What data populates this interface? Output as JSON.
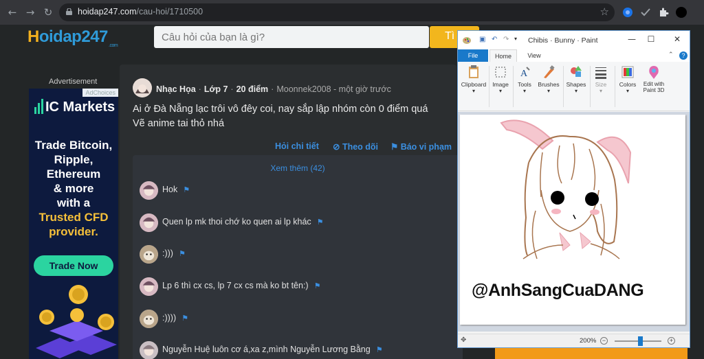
{
  "browser": {
    "url_host": "hoidap247.com",
    "url_path": "/cau-hoi/1710500"
  },
  "site": {
    "logo_prefix": "H",
    "logo_rest": "oidap247",
    "logo_suffix": ".com",
    "search_placeholder": "Câu hỏi của bạn là gì?",
    "search_button": "Tì"
  },
  "ad": {
    "label": "Advertisement",
    "adchoices": "AdChoices",
    "brand": "IC Markets",
    "line1": "Trade Bitcoin,",
    "line2": "Ripple,",
    "line3": "Ethereum",
    "line4": "& more",
    "line5": "with a",
    "line6": "Trusted CFD",
    "line7": "provider.",
    "cta": "Trade Now"
  },
  "post": {
    "author": "Nhạc Họa",
    "grade": "Lớp 7",
    "points": "20 điểm",
    "time": "Moonnek2008 - một giờ trước",
    "line1": "Ai ở Đà Nẵng lạc trôi vô đêy coi, nay sắp lập nhóm còn 0 điểm quá",
    "line2": "Vẽ anime tai thỏ nhá",
    "action_detail": "Hỏi chi tiết",
    "action_follow": "Theo dõi",
    "action_report": "Báo vi phạm"
  },
  "replies": {
    "see_more": "Xem thêm (42)",
    "items": [
      {
        "text": "Hok"
      },
      {
        "text": "Quen lp mk thoi chớ ko quen ai lp khác"
      },
      {
        "text": ":)))"
      },
      {
        "text": "Lp 6 thì cx cs, lp 7 cx cs mà ko bt tên:)"
      },
      {
        "text": ":))))"
      },
      {
        "text": "Nguyễn Huệ luôn cơ á,xa z,mình Nguyễn Lương Bằng"
      }
    ]
  },
  "paint": {
    "title": "Chibis · Bunny · Paint",
    "tab_file": "File",
    "tab_home": "Home",
    "tab_view": "View",
    "groups": {
      "clipboard": "Clipboard",
      "image": "Image",
      "tools": "Tools",
      "brushes": "Brushes",
      "shapes": "Shapes",
      "size": "Size",
      "colors": "Colors",
      "edit3d_1": "Edit with",
      "edit3d_2": "Paint 3D"
    },
    "watermark": "@AnhSangCuaDANG",
    "zoom": "200%"
  }
}
